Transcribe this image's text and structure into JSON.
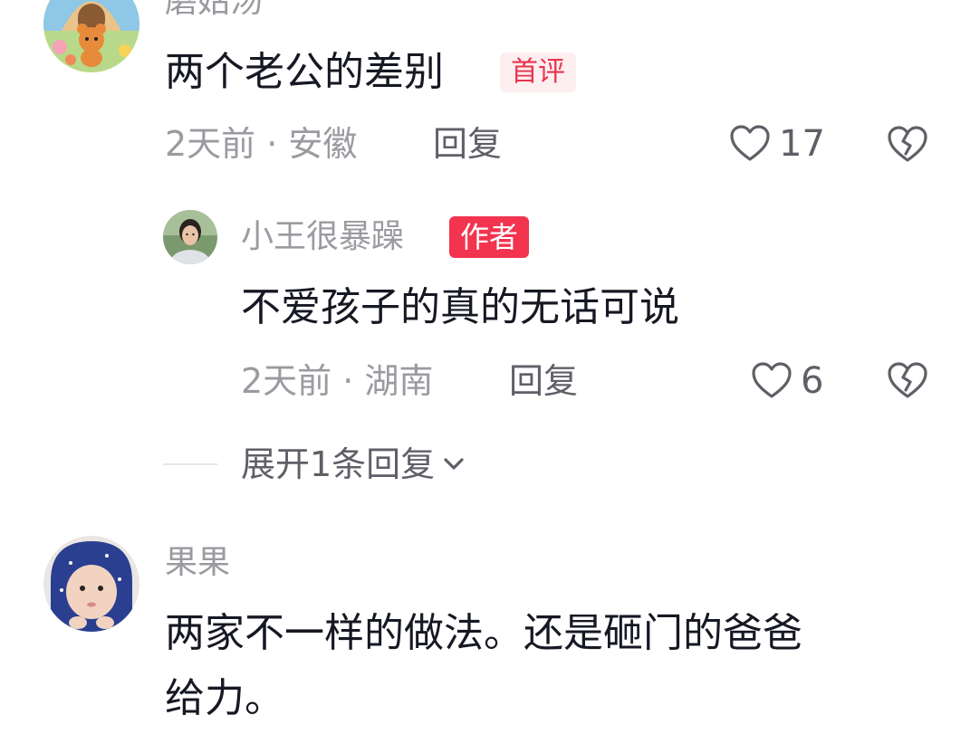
{
  "comment1": {
    "username": "磨姑汤",
    "avatar_icon": "cartoon-bear-avatar",
    "text": "两个老公的差别",
    "badge": "首评",
    "time_location": "2天前 · 安徽",
    "reply_label": "回复",
    "likes": "17",
    "like_icon": "heart-outline-icon",
    "dislike_icon": "broken-heart-icon"
  },
  "reply1": {
    "username": "小王很暴躁",
    "avatar_icon": "woman-photo-avatar",
    "badge": "作者",
    "text": "不爱孩子的真的无话可说",
    "time_location": "2天前 · 湖南",
    "reply_label": "回复",
    "likes": "6"
  },
  "expand": {
    "label": "展开1条回复",
    "icon": "chevron-down-icon"
  },
  "comment2": {
    "username": "果果",
    "avatar_icon": "baby-in-hood-avatar",
    "text_line1": "两家不一样的做法。还是砸门的爸爸",
    "text_line2": "给力。"
  },
  "colors": {
    "accent_red": "#f2344f",
    "muted_text": "#9a9ba0",
    "primary_text": "#161823"
  }
}
